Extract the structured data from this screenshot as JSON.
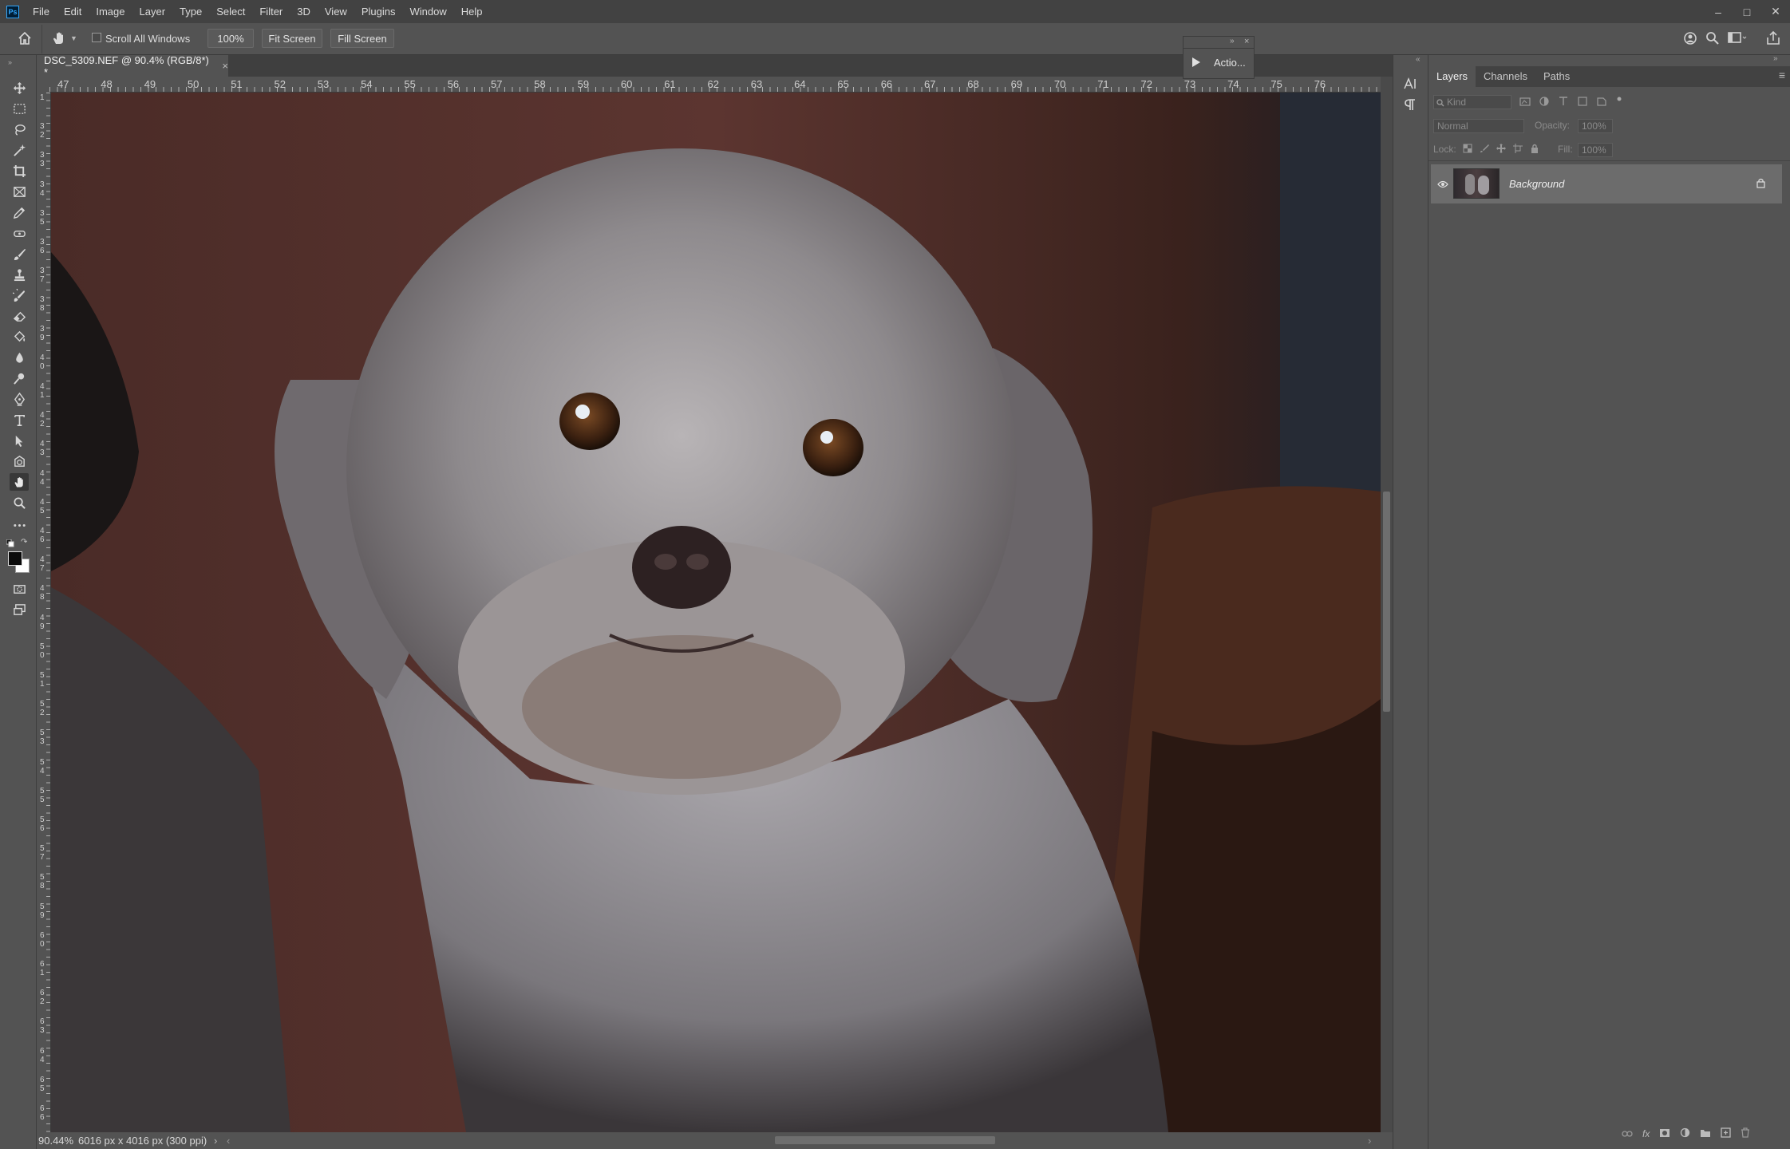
{
  "menu": {
    "logo": "Ps",
    "items": [
      "File",
      "Edit",
      "Image",
      "Layer",
      "Type",
      "Select",
      "Filter",
      "3D",
      "View",
      "Plugins",
      "Window",
      "Help"
    ]
  },
  "options_bar": {
    "scroll_all_windows": "Scroll All Windows",
    "zoom_value": "100%",
    "fit_screen": "Fit Screen",
    "fill_screen": "Fill Screen"
  },
  "document": {
    "tab_title": "DSC_5309.NEF @ 90.4% (RGB/8*) *",
    "close": "×"
  },
  "ruler": {
    "top_labels": [
      "47",
      "48",
      "49",
      "50",
      "51",
      "52",
      "53",
      "54",
      "55",
      "56",
      "57",
      "58",
      "59",
      "60",
      "61",
      "62",
      "63",
      "64",
      "65",
      "66",
      "67",
      "68",
      "69",
      "70",
      "71",
      "72",
      "73",
      "74",
      "75",
      "76"
    ],
    "left_labels": [
      "1",
      "3 2",
      "3 3",
      "3 4",
      "3 5",
      "3 6",
      "3 7",
      "3 8",
      "3 9",
      "4 0",
      "4 1",
      "4 2",
      "4 3",
      "4 4",
      "4 5",
      "4 6",
      "4 7",
      "4 8",
      "4 9",
      "5 0",
      "5 1",
      "5 2",
      "5 3",
      "5 4",
      "5 5",
      "5 6",
      "5 7",
      "5 8",
      "5 9",
      "6 0",
      "6 1",
      "6 2",
      "6 3",
      "6 4",
      "6 5",
      "6 6"
    ]
  },
  "status_bar": {
    "zoom": "90.44%",
    "info": "6016 px x 4016 px (300 ppi)"
  },
  "actions_panel": {
    "label": "Actio...",
    "expand": "»",
    "close": "×"
  },
  "layers_panel": {
    "tabs": [
      "Layers",
      "Channels",
      "Paths"
    ],
    "filter_placeholder": "Kind",
    "blend_mode": "Normal",
    "opacity_label": "Opacity:",
    "opacity_value": "100%",
    "lock_label": "Lock:",
    "fill_label": "Fill:",
    "fill_value": "100%",
    "layers": [
      {
        "name": "Background",
        "visible": true,
        "locked": true
      }
    ]
  },
  "colors": {
    "accent": "#31a8ff",
    "panel_bg": "#535353",
    "menubar_bg": "#424242"
  }
}
